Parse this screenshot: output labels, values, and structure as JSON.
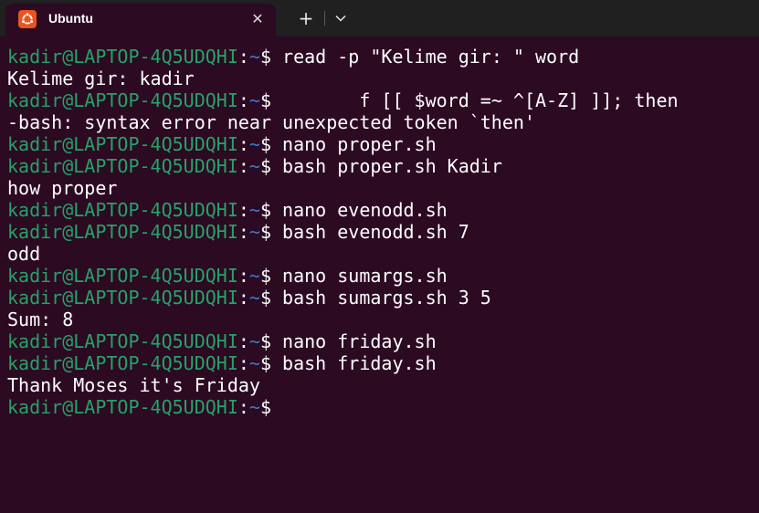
{
  "window": {
    "tab_title": "Ubuntu",
    "tab_icon": "ubuntu-logo-icon",
    "close_icon": "close-icon",
    "new_tab_icon": "plus-icon",
    "dropdown_icon": "chevron-down-icon"
  },
  "colors": {
    "background": "#2c0a22",
    "titlebar": "#202020",
    "prompt_user": "#26a269",
    "prompt_path": "#3c7ac9",
    "text": "#ffffff",
    "ubuntu_accent": "#e95420"
  },
  "terminal": {
    "prompt": {
      "user_host": "kadir@LAPTOP-4Q5UDQHI",
      "separator": ":",
      "path": "~",
      "symbol": "$"
    },
    "lines": [
      {
        "type": "prompt",
        "command": " read -p \"Kelime gir: \" word"
      },
      {
        "type": "output",
        "text": "Kelime gir: kadir"
      },
      {
        "type": "prompt",
        "command": "        f [[ $word =~ ^[A-Z] ]]; then"
      },
      {
        "type": "output",
        "text": "-bash: syntax error near unexpected token `then'"
      },
      {
        "type": "prompt",
        "command": " nano proper.sh"
      },
      {
        "type": "prompt",
        "command": " bash proper.sh Kadir"
      },
      {
        "type": "output",
        "text": "how proper"
      },
      {
        "type": "prompt",
        "command": " nano evenodd.sh"
      },
      {
        "type": "prompt",
        "command": " bash evenodd.sh 7"
      },
      {
        "type": "output",
        "text": "odd"
      },
      {
        "type": "prompt",
        "command": " nano sumargs.sh"
      },
      {
        "type": "prompt",
        "command": " bash sumargs.sh 3 5"
      },
      {
        "type": "output",
        "text": "Sum: 8"
      },
      {
        "type": "prompt",
        "command": " nano friday.sh"
      },
      {
        "type": "prompt",
        "command": " bash friday.sh"
      },
      {
        "type": "output",
        "text": "Thank Moses it's Friday"
      },
      {
        "type": "prompt",
        "command": ""
      }
    ]
  }
}
